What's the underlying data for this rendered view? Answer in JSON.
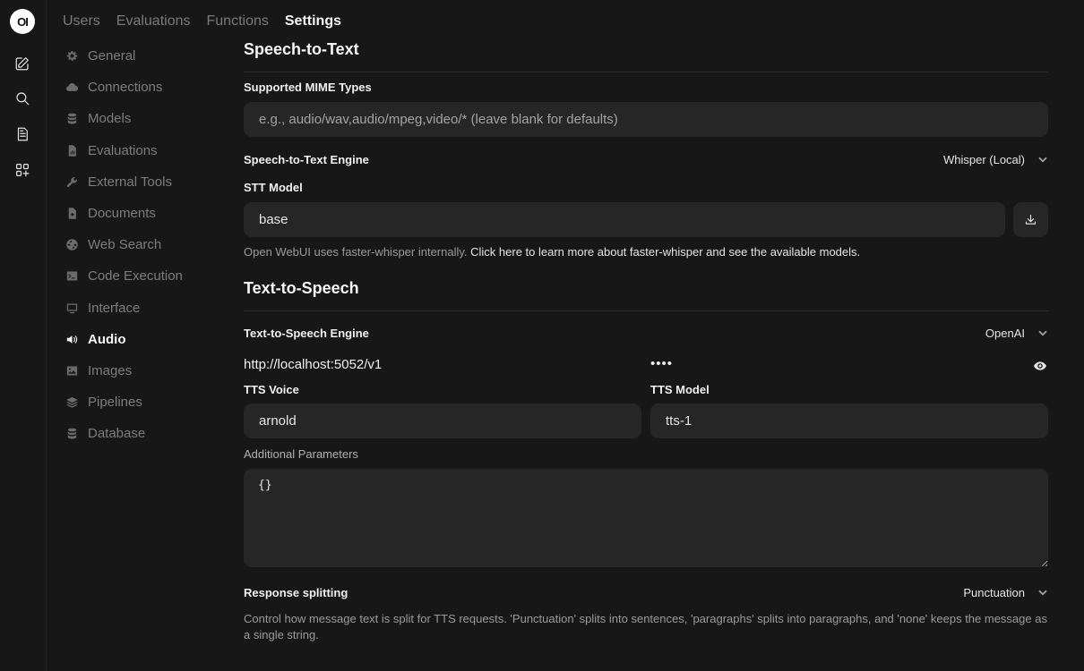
{
  "rail": {
    "logo_text": "OI",
    "icons": [
      "new-chat-icon",
      "search-icon",
      "notes-icon",
      "workspace-icon"
    ]
  },
  "topnav": {
    "tabs": [
      {
        "label": "Users"
      },
      {
        "label": "Evaluations"
      },
      {
        "label": "Functions"
      },
      {
        "label": "Settings",
        "active": true
      }
    ]
  },
  "sidebar": {
    "items": [
      {
        "label": "General",
        "icon": "gear-icon"
      },
      {
        "label": "Connections",
        "icon": "cloud-icon"
      },
      {
        "label": "Models",
        "icon": "database-icon"
      },
      {
        "label": "Evaluations",
        "icon": "document-chart-icon"
      },
      {
        "label": "External Tools",
        "icon": "wrench-icon"
      },
      {
        "label": "Documents",
        "icon": "document-icon"
      },
      {
        "label": "Web Search",
        "icon": "globe-icon"
      },
      {
        "label": "Code Execution",
        "icon": "terminal-icon"
      },
      {
        "label": "Interface",
        "icon": "monitor-icon"
      },
      {
        "label": "Audio",
        "icon": "speaker-icon",
        "active": true
      },
      {
        "label": "Images",
        "icon": "image-icon"
      },
      {
        "label": "Pipelines",
        "icon": "layers-icon"
      },
      {
        "label": "Database",
        "icon": "database-icon"
      }
    ]
  },
  "stt": {
    "heading": "Speech-to-Text",
    "mime_label": "Supported MIME Types",
    "mime_placeholder": "e.g., audio/wav,audio/mpeg,video/* (leave blank for defaults)",
    "engine_label": "Speech-to-Text Engine",
    "engine_value": "Whisper (Local)",
    "model_label": "STT Model",
    "model_value": "base",
    "note_prefix": "Open WebUI uses faster-whisper internally.",
    "note_link": "Click here to learn more about faster-whisper and see the available models."
  },
  "tts": {
    "heading": "Text-to-Speech",
    "engine_label": "Text-to-Speech Engine",
    "engine_value": "OpenAI",
    "base_url": "http://localhost:5052/v1",
    "api_key_masked": "••••",
    "voice_label": "TTS Voice",
    "voice_value": "arnold",
    "model_label": "TTS Model",
    "model_value": "tts-1",
    "params_label": "Additional Parameters",
    "params_value": "{}",
    "splitting_label": "Response splitting",
    "splitting_value": "Punctuation",
    "splitting_note": "Control how message text is split for TTS requests. 'Punctuation' splits into sentences, 'paragraphs' splits into paragraphs, and 'none' keeps the message as a single string."
  }
}
